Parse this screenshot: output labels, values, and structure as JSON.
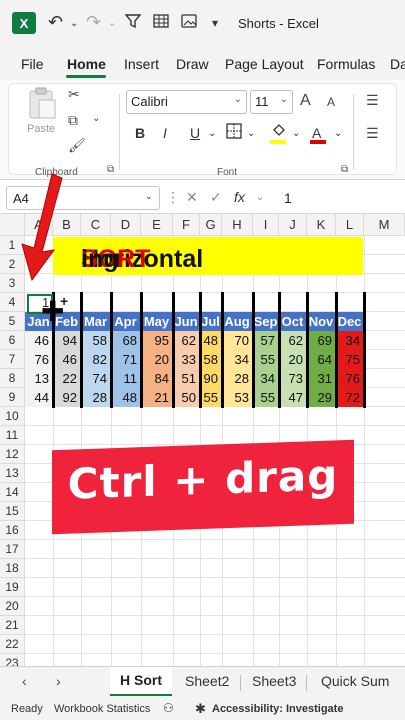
{
  "titlebar": {
    "title": "Shorts  -  Excel",
    "logo": "X"
  },
  "tabs": [
    "File",
    "Home",
    "Insert",
    "Draw",
    "Page Layout",
    "Formulas",
    "Da"
  ],
  "ribbon": {
    "paste_label": "Paste",
    "clipboard_label": "Clipboard",
    "font_label": "Font",
    "font_name": "Calibri",
    "font_size": "11",
    "bold": "B",
    "italic": "I",
    "underline": "U",
    "grow_font": "A",
    "shrink_font": "A",
    "font_color_glyph": "A",
    "dialog_launcher": "⧉"
  },
  "formula_bar": {
    "name_box": "A4",
    "fx": "fx",
    "value": "1"
  },
  "columns": [
    "A",
    "B",
    "C",
    "D",
    "E",
    "F",
    "G",
    "H",
    "I",
    "J",
    "K",
    "L",
    "M"
  ],
  "rows": [
    "1",
    "2",
    "3",
    "4",
    "5",
    "6",
    "7",
    "8",
    "9",
    "10",
    "11",
    "12",
    "13",
    "14",
    "15",
    "16",
    "17",
    "18",
    "19",
    "20",
    "21",
    "22",
    "23"
  ],
  "sheet": {
    "title_part1": "Horizontal ",
    "title_part2": "SORT",
    "title_part3": "ing",
    "cell_a4": "1",
    "cross_cursor": "✚",
    "plus": "+",
    "months": [
      "Jan",
      "Feb",
      "Mar",
      "Apr",
      "May",
      "Jun",
      "Jul",
      "Aug",
      "Sep",
      "Oct",
      "Nov",
      "Dec"
    ],
    "values": [
      [
        "46",
        "94",
        "58",
        "68",
        "95",
        "62",
        "48",
        "70",
        "57",
        "62",
        "69",
        "34"
      ],
      [
        "76",
        "46",
        "82",
        "71",
        "20",
        "33",
        "58",
        "34",
        "55",
        "20",
        "64",
        "75"
      ],
      [
        "13",
        "22",
        "74",
        "11",
        "84",
        "51",
        "90",
        "28",
        "34",
        "73",
        "31",
        "76"
      ],
      [
        "44",
        "92",
        "28",
        "48",
        "21",
        "50",
        "55",
        "53",
        "55",
        "47",
        "29",
        "72"
      ]
    ],
    "col_colors": [
      "#f2f2f2",
      "#d9d9d9",
      "#bdd7ee",
      "#9dc3e6",
      "#f4b183",
      "#f8cbad",
      "#ffd966",
      "#ffe699",
      "#a9d08e",
      "#c6e0b4",
      "#70ad47",
      "#e31a1a"
    ]
  },
  "overlay": {
    "caption": "Ctrl + drag"
  },
  "sheet_tabs": [
    "H Sort",
    "Sheet2",
    "Sheet3",
    "Quick Sum"
  ],
  "statusbar": {
    "ready": "Ready",
    "workbook_stats": "Workbook Statistics",
    "accessibility": "Accessibility: Investigate"
  },
  "colors": {
    "excel_green": "#107c41",
    "banner_red": "#f0233d",
    "title_yellow": "#ffff00",
    "month_blue": "#4472c4"
  }
}
